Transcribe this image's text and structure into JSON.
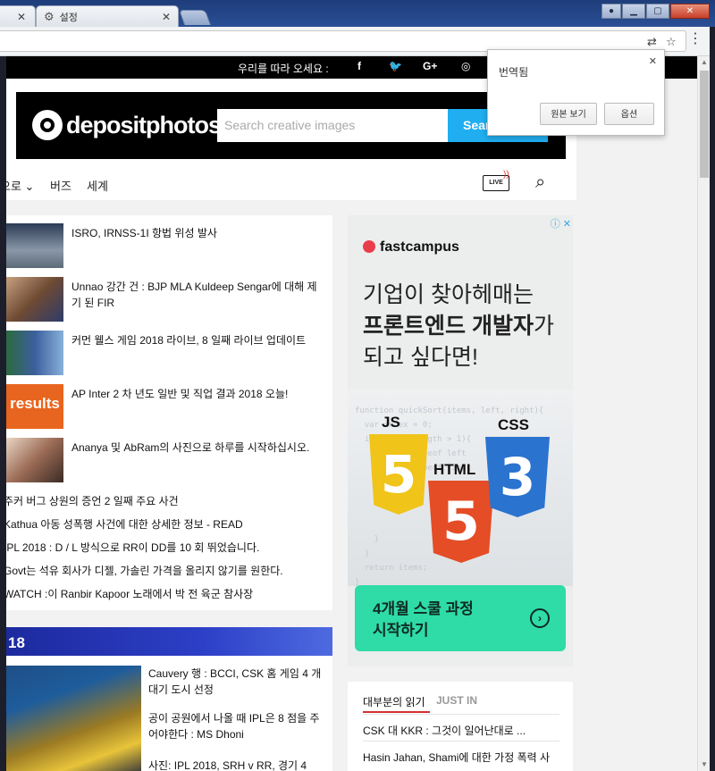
{
  "browser": {
    "tabs": [
      {
        "label": ""
      },
      {
        "label": "설정"
      }
    ]
  },
  "translate_bubble": {
    "title": "번역됨",
    "show_original": "원본 보기",
    "options": "옵션"
  },
  "site": {
    "follow_label": "우리를 따라 오세요 :",
    "social": [
      "f",
      "t",
      "G+",
      "ig"
    ],
    "logo_text": "depositphotos",
    "search_placeholder": "Search creative images",
    "search_button": "Sear",
    "nav": [
      "으로 ⌄",
      "버즈",
      "세계"
    ],
    "live_label": "LIVE"
  },
  "news": {
    "thumb_items": [
      {
        "title": "ISRO, IRNSS-1I 항법 위성 발사"
      },
      {
        "title": "Unnao 강간 건 : BJP MLA Kuldeep Sengar에 대해 제기 된 FIR"
      },
      {
        "title": "커먼 웰스 게임 2018 라이브, 8 일째 라이브 업데이트"
      },
      {
        "title": "AP Inter 2 차 년도 일반 및 직업 결과 2018 오늘!",
        "thumb_text": "results"
      },
      {
        "title": "Ananya 및 AbRam의 사진으로 하루를 시작하십시오."
      }
    ],
    "text_items": [
      "주커 버그 상원의 증언 2 일째 주요 사건",
      "Kathua 아동 성폭행 사건에 대한 상세한 정보 - READ",
      "IPL 2018 : D / L 방식으로 RR이 DD를 10 회 뛰었습니다.",
      "Govt는 석유 회사가 디젤, 가솔린 가격을 올리지 않기를 원한다.",
      "WATCH :이 Ranbir Kapoor 노래에서 박 전 육군 참사장"
    ]
  },
  "ipl": {
    "header": "18",
    "items": [
      "Cauvery 행 : BCCI, CSK 홈 게임 4 개 대기 도시 선정",
      "공이 공원에서 나올 때 IPL은 8 점을 주어야한다 : MS Dhoni",
      "사진: IPL 2018, SRH v RR, 경기 4"
    ]
  },
  "ad": {
    "brand": "fastcampus",
    "headline_line1": "기업이 찾아헤매는",
    "headline_bold": "프론트엔드 개발자",
    "headline_suffix": "가",
    "headline_line3": "되고 싶다면!",
    "code_text": "function quickSort(items, left, right){\n  var index = 0;\n  if (items.length > 1){\n    index = typeof left\n    right = typeof right\n\n\n\n\n    }\n  }\n  return items;\n}\n// first call\nvar result = quickSort(items);",
    "badge_js_label": "JS",
    "badge_js_glyph": "5",
    "badge_html_label": "HTML",
    "badge_html_glyph": "5",
    "badge_css_label": "CSS",
    "badge_css_glyph": "3",
    "cta_line1": "4개월 스쿨 과정",
    "cta_line2": "시작하기"
  },
  "most_read": {
    "tab_active": "대부분의 읽기",
    "tab_inactive": "JUST IN",
    "items": [
      "CSK 대 KKR : 그것이 일어난대로 ...",
      "Hasin Jahan, Shami에 대한 가정 폭력 사"
    ]
  },
  "colors": {
    "search_button": "#20aef0",
    "ipl_header": "#2c3fc7",
    "ad_cta": "#2fdba6",
    "most_read_underline": "#d32f2f",
    "fastcampus_dot": "#ea3d4a"
  }
}
